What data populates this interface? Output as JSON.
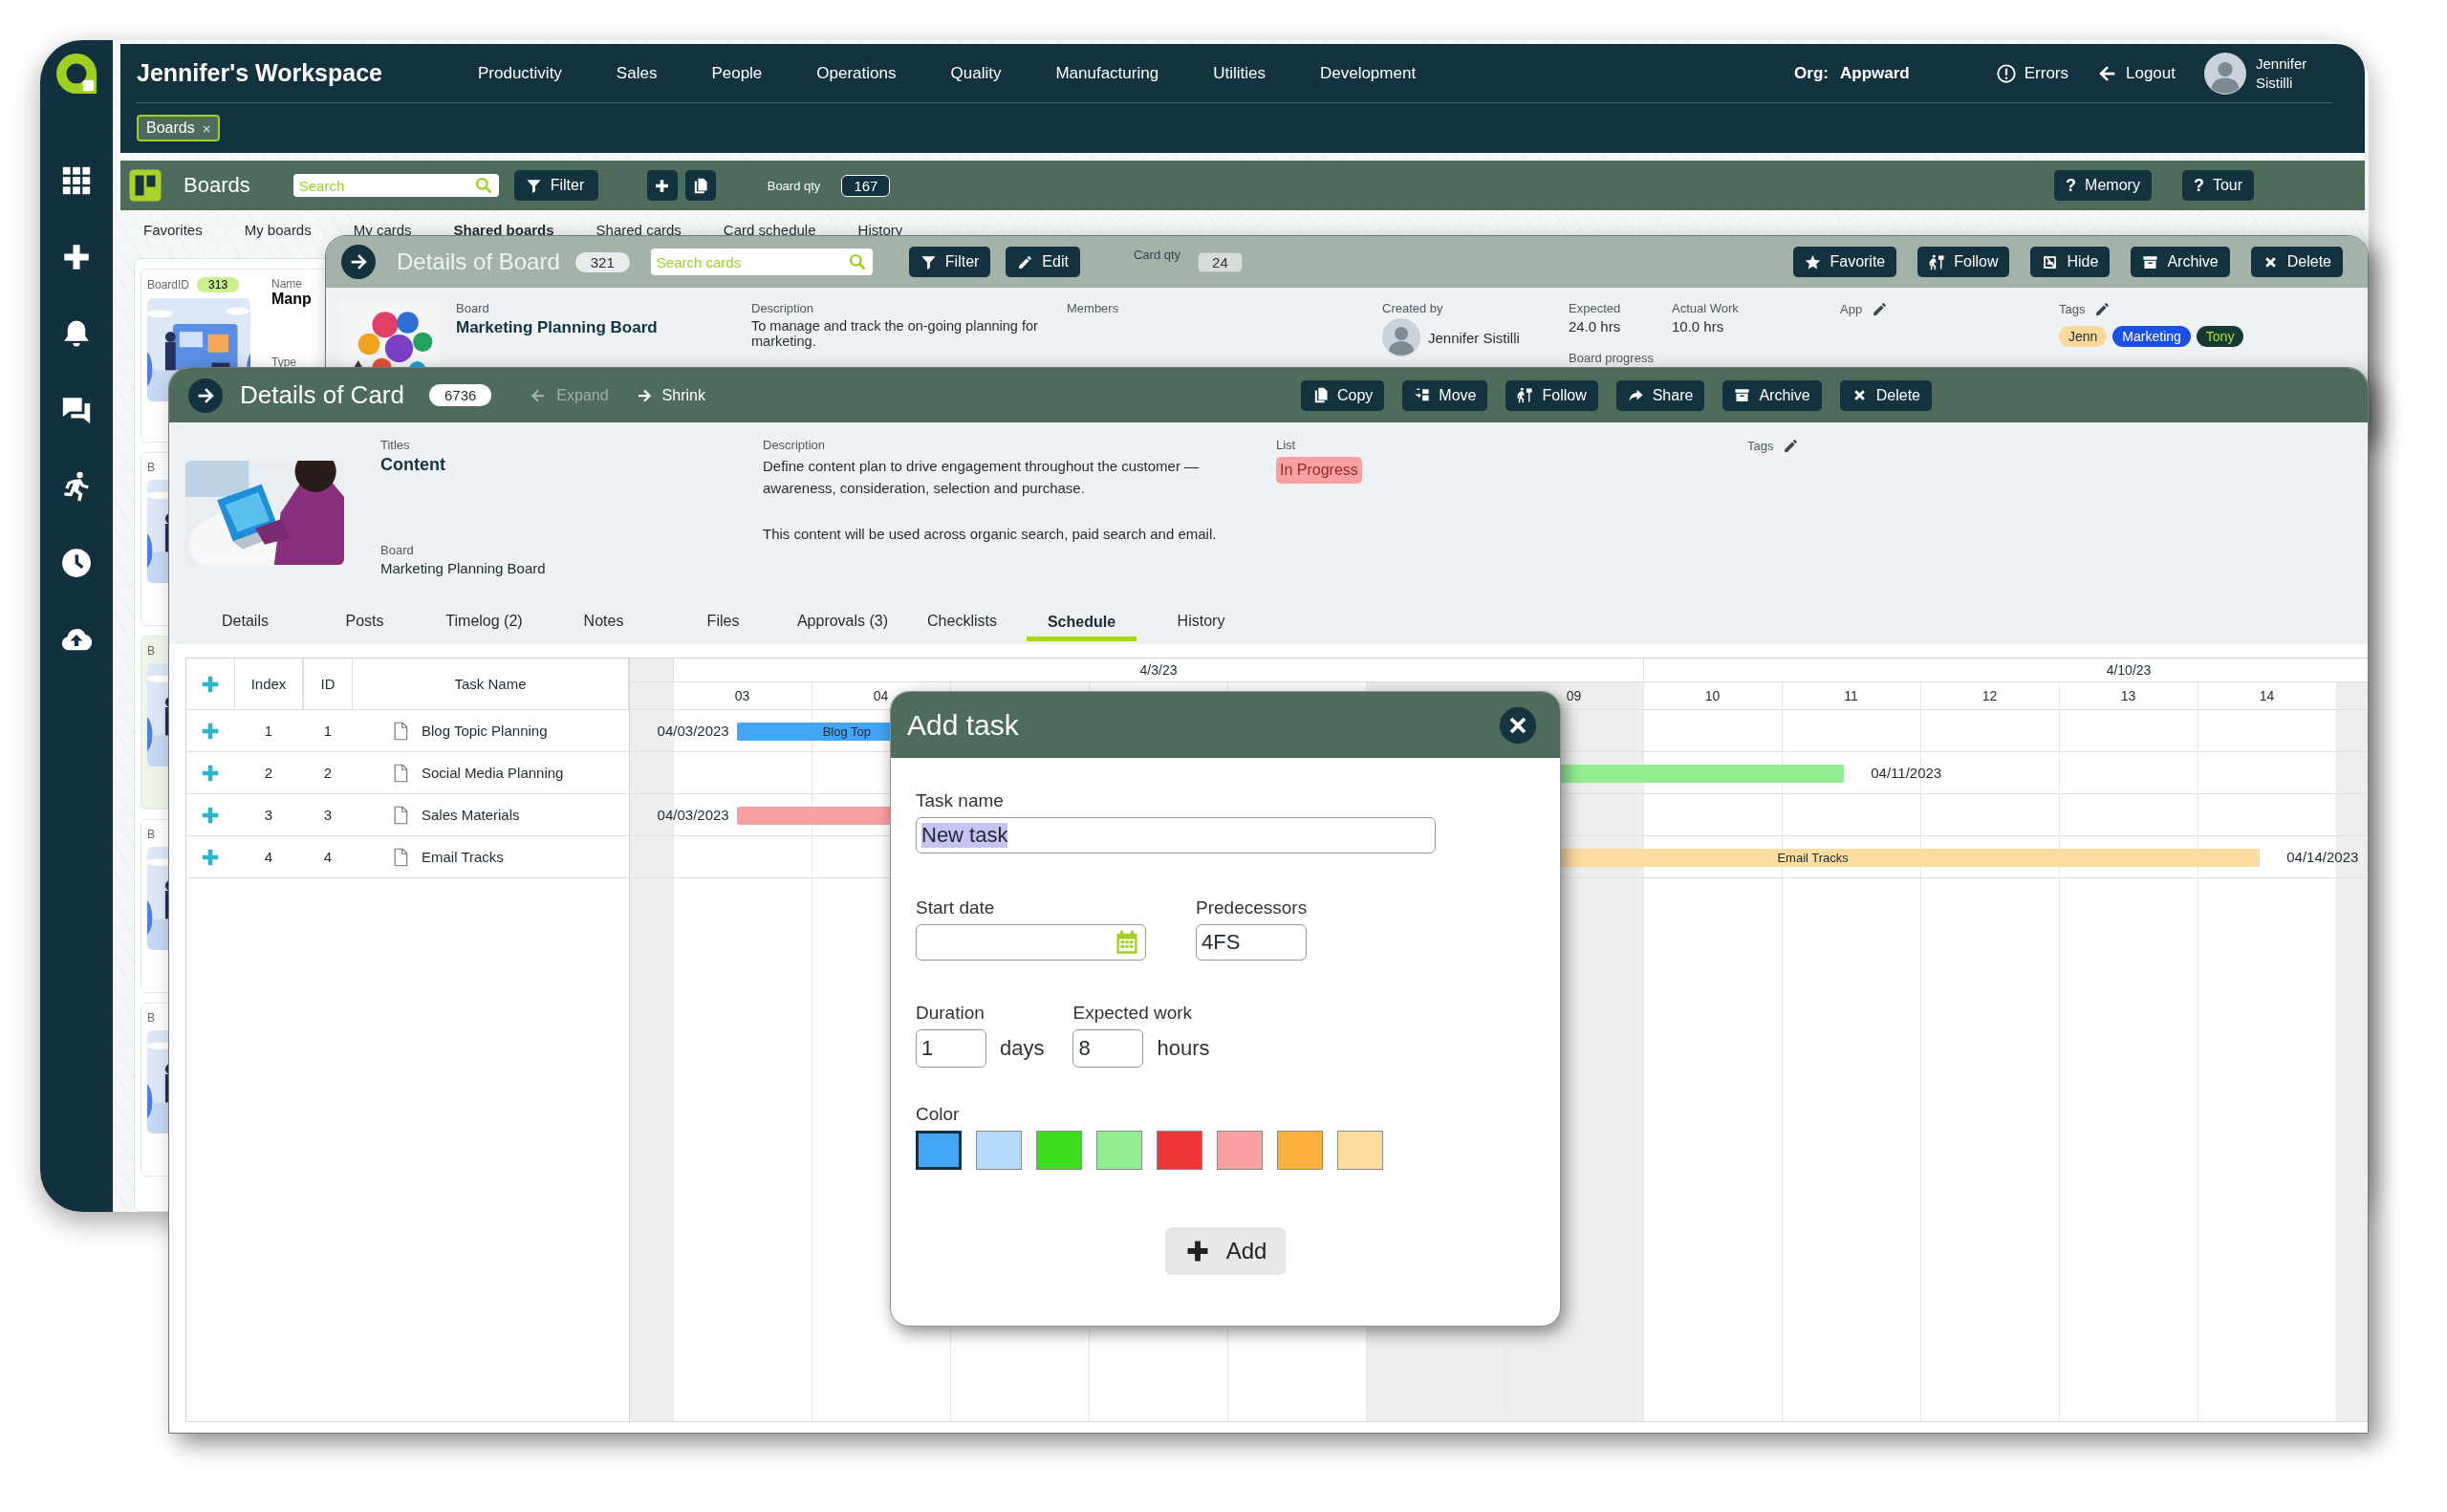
{
  "header": {
    "title": "Jennifer's Workspace",
    "nav": [
      "Productivity",
      "Sales",
      "People",
      "Operations",
      "Quality",
      "Manufacturing",
      "Utilities",
      "Development"
    ],
    "org_label": "Org:",
    "org": "Appward",
    "errors": "Errors",
    "logout": "Logout",
    "user": "Jennifer Sistilli",
    "open_tabs": [
      {
        "label": "Boards",
        "close": "×"
      }
    ]
  },
  "boards_bar": {
    "title": "Boards",
    "search_placeholder": "Search",
    "filter": "Filter",
    "qty_label": "Board qty",
    "qty": "167",
    "help": [
      {
        "mark": "?",
        "label": "Memory"
      },
      {
        "mark": "?",
        "label": "Tour"
      }
    ]
  },
  "boards_tabs": [
    {
      "label": "Favorites",
      "selected": false
    },
    {
      "label": "My boards",
      "selected": false
    },
    {
      "label": "My cards",
      "selected": false
    },
    {
      "label": "Shared boards",
      "selected": true
    },
    {
      "label": "Shared cards",
      "selected": false
    },
    {
      "label": "Card schedule",
      "selected": false
    },
    {
      "label": "History",
      "selected": false
    }
  ],
  "board_list": [
    {
      "id_label": "BoardID",
      "id": "313",
      "name_label": "Name",
      "name": "Manp",
      "type_label": "Type",
      "highlighted": false
    },
    {
      "id_label": "B",
      "highlighted": false
    },
    {
      "id_label": "B",
      "highlighted": true
    },
    {
      "id_label": "B",
      "highlighted": false
    },
    {
      "id_label": "B",
      "highlighted": false
    }
  ],
  "board_details": {
    "title": "Details of Board",
    "count": "321",
    "search_placeholder": "Search cards",
    "filter": "Filter",
    "edit": "Edit",
    "qty_label": "Card qty",
    "qty": "24",
    "actions": [
      "Favorite",
      "Follow",
      "Hide",
      "Archive",
      "Delete"
    ],
    "board_label": "Board",
    "board": "Marketing Planning Board",
    "description_label": "Description",
    "description": "To manage and track the on-going planning for marketing.",
    "members_label": "Members",
    "created_label": "Created by",
    "created_by": "Jennifer Sistilli",
    "expected_label": "Expected",
    "expected": "24.0 hrs",
    "actual_label": "Actual Work",
    "actual": "10.0 hrs",
    "progress_label": "Board progress",
    "app_label": "App",
    "tags_label": "Tags",
    "tags": [
      {
        "label": "Jenn",
        "color": "#fcd99a"
      },
      {
        "label": "Marketing",
        "color": "#1b4fe8"
      },
      {
        "label": "Tony",
        "color": "#163a33"
      }
    ]
  },
  "card_details": {
    "title": "Details of Card",
    "count": "6736",
    "nav": [
      {
        "label": "Expand",
        "disabled": true
      },
      {
        "label": "Shrink",
        "disabled": false
      }
    ],
    "actions": [
      "Copy",
      "Move",
      "Follow",
      "Share",
      "Archive",
      "Delete"
    ],
    "titles_label": "Titles",
    "title_value": "Content",
    "board_label": "Board",
    "board": "Marketing Planning Board",
    "description_label": "Description",
    "description": [
      "Define content plan to drive engagement throughout the customer —awareness, consideration, selection and purchase.",
      "This content will be used across organic search, paid search and email."
    ],
    "list_label": "List",
    "list": "In Progress",
    "tags_label": "Tags",
    "tabs": [
      {
        "label": "Details",
        "selected": false
      },
      {
        "label": "Posts",
        "selected": false
      },
      {
        "label": "Timelog (2)",
        "selected": false
      },
      {
        "label": "Notes",
        "selected": false
      },
      {
        "label": "Files",
        "selected": false
      },
      {
        "label": "Approvals (3)",
        "selected": false
      },
      {
        "label": "Checklists",
        "selected": false
      },
      {
        "label": "Schedule",
        "selected": true
      },
      {
        "label": "History",
        "selected": false
      }
    ]
  },
  "schedule": {
    "columns": [
      "Index",
      "ID",
      "Task Name"
    ],
    "weeks": [
      "4/3/23",
      "4/10/23"
    ],
    "days": [
      {
        "weekend": true
      },
      {
        "label": "03",
        "weekend": false
      },
      {
        "label": "04",
        "weekend": false
      },
      {
        "weekend": false
      },
      {
        "weekend": false
      },
      {
        "weekend": false
      },
      {
        "weekend": true
      },
      {
        "label": "09",
        "weekend": true
      },
      {
        "label": "10",
        "weekend": false
      },
      {
        "label": "11",
        "weekend": false
      },
      {
        "label": "12",
        "weekend": false
      },
      {
        "label": "13",
        "weekend": false
      },
      {
        "label": "14",
        "weekend": false
      },
      {
        "weekend": true
      }
    ],
    "tasks": [
      {
        "index": "1",
        "id": "1",
        "name": "Blog Topic Planning",
        "bar": {
          "color": "#42a5f5",
          "label": "Blog Top",
          "start_date": "04/03/2023"
        }
      },
      {
        "index": "2",
        "id": "2",
        "name": "Social Media Planning",
        "bar": {
          "color": "#90ee90",
          "end_date": "04/11/2023"
        }
      },
      {
        "index": "3",
        "id": "3",
        "name": "Sales Materials",
        "bar": {
          "color": "#f9a0a0",
          "start_date": "04/03/2023"
        }
      },
      {
        "index": "4",
        "id": "4",
        "name": "Email Tracks",
        "bar": {
          "color": "#fddc9f",
          "label": "Email Tracks",
          "end_date": "04/14/2023"
        }
      }
    ]
  },
  "add_task": {
    "title": "Add task",
    "task_name_label": "Task name",
    "task_name": "New task",
    "task_name_selected": true,
    "start_date_label": "Start date",
    "predecessors_label": "Predecessors",
    "predecessors": "4FS",
    "duration_label": "Duration",
    "duration": "1",
    "duration_unit": "days",
    "work_label": "Expected work",
    "work": "8",
    "work_unit": "hours",
    "color_label": "Color",
    "colors": [
      {
        "color": "#42a5f5",
        "selected": true
      },
      {
        "color": "#b3d9fb",
        "selected": false
      },
      {
        "color": "#3cdc1f",
        "selected": false
      },
      {
        "color": "#90ee90",
        "selected": false
      },
      {
        "color": "#ef3535",
        "selected": false
      },
      {
        "color": "#f9a0a0",
        "selected": false
      },
      {
        "color": "#fbb13c",
        "selected": false
      },
      {
        "color": "#fddc9f",
        "selected": false
      }
    ],
    "add": "Add"
  }
}
